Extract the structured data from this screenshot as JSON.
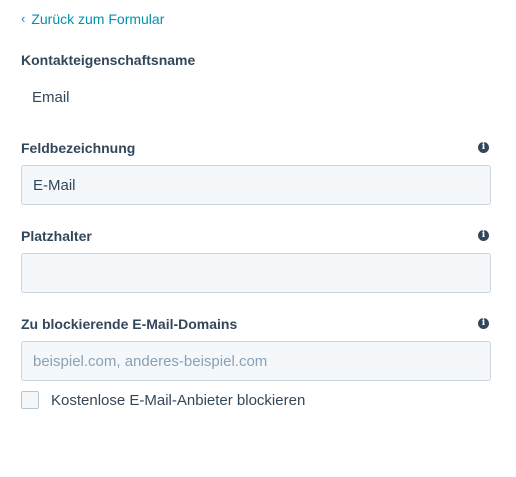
{
  "back_link": {
    "label": "Zurück zum Formular"
  },
  "property_name": {
    "label": "Kontakteigenschaftsname",
    "value": "Email"
  },
  "field_label": {
    "label": "Feldbezeichnung",
    "value": "E-Mail",
    "info_icon": "info-icon"
  },
  "placeholder": {
    "label": "Platzhalter",
    "value": "",
    "info_icon": "info-icon"
  },
  "blocked_domains": {
    "label": "Zu blockierende E-Mail-Domains",
    "value": "",
    "placeholder": "beispiel.com, anderes-beispiel.com",
    "info_icon": "info-icon"
  },
  "block_free_providers": {
    "label": "Kostenlose E-Mail-Anbieter blockieren",
    "checked": false
  },
  "colors": {
    "link": "#0091ae",
    "text": "#33475b",
    "input_bg": "#f5f8fa",
    "input_border": "#cbd6e2"
  }
}
